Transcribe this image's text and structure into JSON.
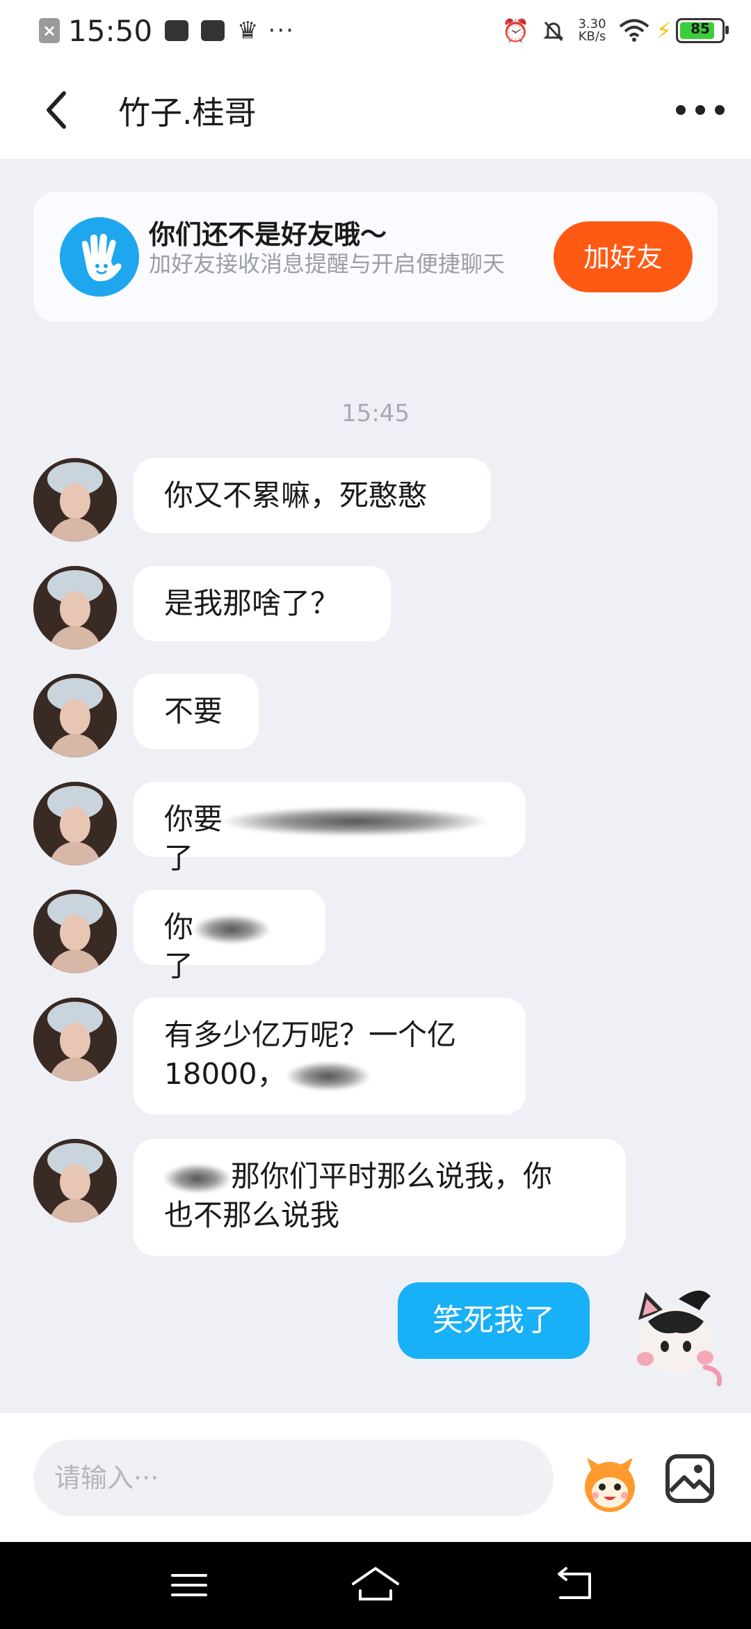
{
  "status_bar": {
    "time": "15:50",
    "network_speed": "3.30",
    "network_unit": "KB/s",
    "battery_level": "85",
    "icons": [
      "close-notification-icon",
      "vivo-app-icon",
      "wallet-icon",
      "crown-icon",
      "more-dots-icon",
      "alarm-icon",
      "mute-icon",
      "wifi-icon",
      "charging-icon",
      "battery-icon"
    ]
  },
  "header": {
    "title": "竹子.桂哥",
    "back_icon": "chevron-left-icon",
    "more_icon": "more-horizontal-icon"
  },
  "friend_notice": {
    "title": "你们还不是好友哦～",
    "subtitle": "加好友接收消息提醒与开启便捷聊天",
    "button_label": "加好友",
    "button_color": "#ff5a13",
    "icon": "waving-hand-icon"
  },
  "chat": {
    "timestamp": "15:45",
    "messages": [
      {
        "from": "other",
        "text": "你又不累嘛，死憨憨"
      },
      {
        "from": "other",
        "text": "是我那啥了？"
      },
      {
        "from": "other",
        "text": "不要"
      },
      {
        "from": "other",
        "text_start": "你要",
        "text_end": "了"
      },
      {
        "from": "other",
        "text_start": "你",
        "text_end": "了"
      },
      {
        "from": "other",
        "line1": "有多少亿万呢？一个亿",
        "line2": "18000，"
      },
      {
        "from": "other",
        "line1": "那你们平时那么说我，你",
        "line2": "也不那么说我"
      },
      {
        "from": "me",
        "text": "笑死我了"
      }
    ],
    "my_bubble_color": "#18b0f6"
  },
  "input_bar": {
    "placeholder": "请输入···",
    "emoji_icon": "emoji-face-icon",
    "image_icon": "image-picker-icon"
  },
  "nav_bar": {
    "icons": [
      "menu-icon",
      "home-icon",
      "back-icon"
    ]
  }
}
